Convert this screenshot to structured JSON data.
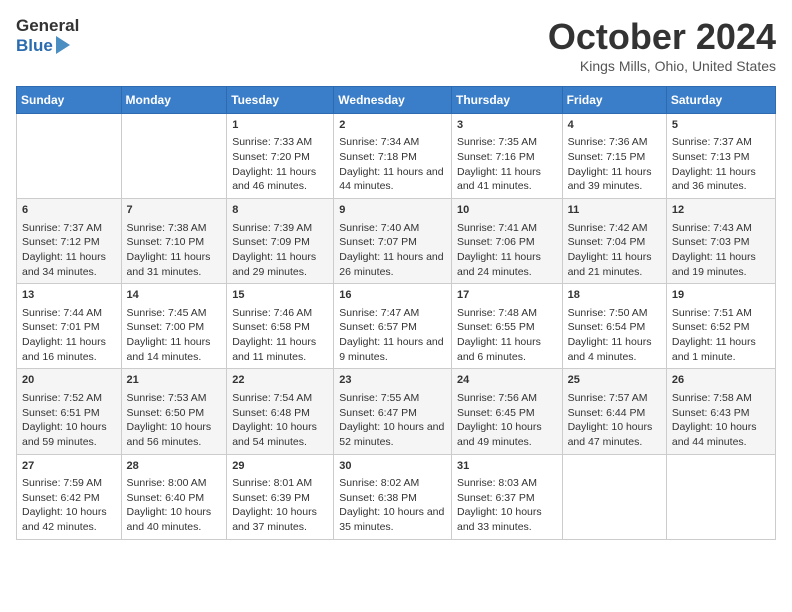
{
  "header": {
    "logo_line1": "General",
    "logo_line2": "Blue",
    "month": "October 2024",
    "location": "Kings Mills, Ohio, United States"
  },
  "days_of_week": [
    "Sunday",
    "Monday",
    "Tuesday",
    "Wednesday",
    "Thursday",
    "Friday",
    "Saturday"
  ],
  "weeks": [
    [
      {
        "day": "",
        "data": ""
      },
      {
        "day": "",
        "data": ""
      },
      {
        "day": "1",
        "data": "Sunrise: 7:33 AM\nSunset: 7:20 PM\nDaylight: 11 hours and 46 minutes."
      },
      {
        "day": "2",
        "data": "Sunrise: 7:34 AM\nSunset: 7:18 PM\nDaylight: 11 hours and 44 minutes."
      },
      {
        "day": "3",
        "data": "Sunrise: 7:35 AM\nSunset: 7:16 PM\nDaylight: 11 hours and 41 minutes."
      },
      {
        "day": "4",
        "data": "Sunrise: 7:36 AM\nSunset: 7:15 PM\nDaylight: 11 hours and 39 minutes."
      },
      {
        "day": "5",
        "data": "Sunrise: 7:37 AM\nSunset: 7:13 PM\nDaylight: 11 hours and 36 minutes."
      }
    ],
    [
      {
        "day": "6",
        "data": "Sunrise: 7:37 AM\nSunset: 7:12 PM\nDaylight: 11 hours and 34 minutes."
      },
      {
        "day": "7",
        "data": "Sunrise: 7:38 AM\nSunset: 7:10 PM\nDaylight: 11 hours and 31 minutes."
      },
      {
        "day": "8",
        "data": "Sunrise: 7:39 AM\nSunset: 7:09 PM\nDaylight: 11 hours and 29 minutes."
      },
      {
        "day": "9",
        "data": "Sunrise: 7:40 AM\nSunset: 7:07 PM\nDaylight: 11 hours and 26 minutes."
      },
      {
        "day": "10",
        "data": "Sunrise: 7:41 AM\nSunset: 7:06 PM\nDaylight: 11 hours and 24 minutes."
      },
      {
        "day": "11",
        "data": "Sunrise: 7:42 AM\nSunset: 7:04 PM\nDaylight: 11 hours and 21 minutes."
      },
      {
        "day": "12",
        "data": "Sunrise: 7:43 AM\nSunset: 7:03 PM\nDaylight: 11 hours and 19 minutes."
      }
    ],
    [
      {
        "day": "13",
        "data": "Sunrise: 7:44 AM\nSunset: 7:01 PM\nDaylight: 11 hours and 16 minutes."
      },
      {
        "day": "14",
        "data": "Sunrise: 7:45 AM\nSunset: 7:00 PM\nDaylight: 11 hours and 14 minutes."
      },
      {
        "day": "15",
        "data": "Sunrise: 7:46 AM\nSunset: 6:58 PM\nDaylight: 11 hours and 11 minutes."
      },
      {
        "day": "16",
        "data": "Sunrise: 7:47 AM\nSunset: 6:57 PM\nDaylight: 11 hours and 9 minutes."
      },
      {
        "day": "17",
        "data": "Sunrise: 7:48 AM\nSunset: 6:55 PM\nDaylight: 11 hours and 6 minutes."
      },
      {
        "day": "18",
        "data": "Sunrise: 7:50 AM\nSunset: 6:54 PM\nDaylight: 11 hours and 4 minutes."
      },
      {
        "day": "19",
        "data": "Sunrise: 7:51 AM\nSunset: 6:52 PM\nDaylight: 11 hours and 1 minute."
      }
    ],
    [
      {
        "day": "20",
        "data": "Sunrise: 7:52 AM\nSunset: 6:51 PM\nDaylight: 10 hours and 59 minutes."
      },
      {
        "day": "21",
        "data": "Sunrise: 7:53 AM\nSunset: 6:50 PM\nDaylight: 10 hours and 56 minutes."
      },
      {
        "day": "22",
        "data": "Sunrise: 7:54 AM\nSunset: 6:48 PM\nDaylight: 10 hours and 54 minutes."
      },
      {
        "day": "23",
        "data": "Sunrise: 7:55 AM\nSunset: 6:47 PM\nDaylight: 10 hours and 52 minutes."
      },
      {
        "day": "24",
        "data": "Sunrise: 7:56 AM\nSunset: 6:45 PM\nDaylight: 10 hours and 49 minutes."
      },
      {
        "day": "25",
        "data": "Sunrise: 7:57 AM\nSunset: 6:44 PM\nDaylight: 10 hours and 47 minutes."
      },
      {
        "day": "26",
        "data": "Sunrise: 7:58 AM\nSunset: 6:43 PM\nDaylight: 10 hours and 44 minutes."
      }
    ],
    [
      {
        "day": "27",
        "data": "Sunrise: 7:59 AM\nSunset: 6:42 PM\nDaylight: 10 hours and 42 minutes."
      },
      {
        "day": "28",
        "data": "Sunrise: 8:00 AM\nSunset: 6:40 PM\nDaylight: 10 hours and 40 minutes."
      },
      {
        "day": "29",
        "data": "Sunrise: 8:01 AM\nSunset: 6:39 PM\nDaylight: 10 hours and 37 minutes."
      },
      {
        "day": "30",
        "data": "Sunrise: 8:02 AM\nSunset: 6:38 PM\nDaylight: 10 hours and 35 minutes."
      },
      {
        "day": "31",
        "data": "Sunrise: 8:03 AM\nSunset: 6:37 PM\nDaylight: 10 hours and 33 minutes."
      },
      {
        "day": "",
        "data": ""
      },
      {
        "day": "",
        "data": ""
      }
    ]
  ]
}
